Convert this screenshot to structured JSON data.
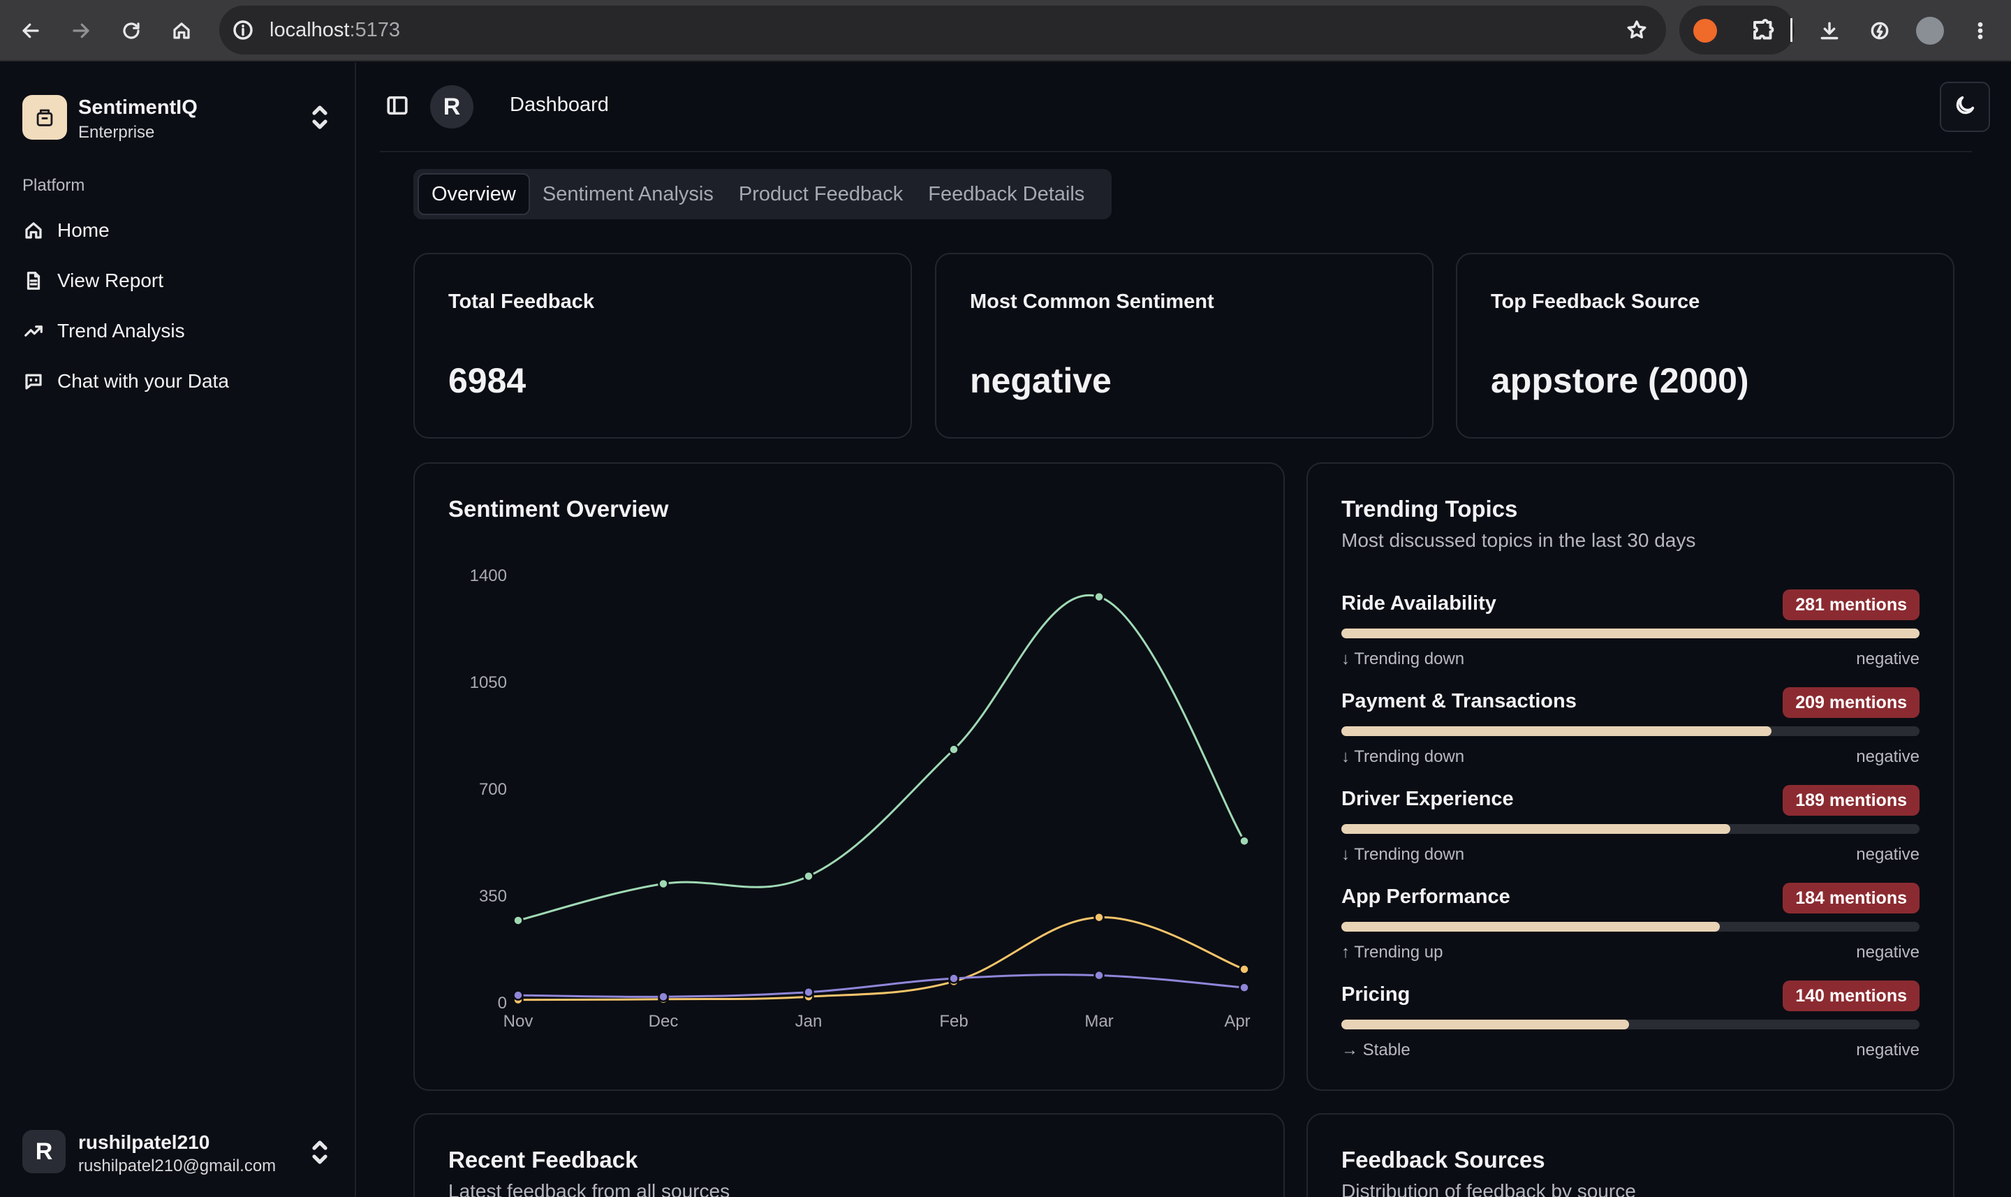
{
  "browser": {
    "url_host": "localhost",
    "url_port": ":5173"
  },
  "sidebar": {
    "brand_name": "SentimentIQ",
    "brand_plan": "Enterprise",
    "section_label": "Platform",
    "items": [
      {
        "label": "Home",
        "icon": "home-icon"
      },
      {
        "label": "View Report",
        "icon": "file-text-icon"
      },
      {
        "label": "Trend Analysis",
        "icon": "trending-up-icon"
      },
      {
        "label": "Chat with your Data",
        "icon": "message-bot-icon"
      }
    ],
    "user": {
      "initial": "R",
      "name": "rushilpatel210",
      "email": "rushilpatel210@gmail.com"
    }
  },
  "header": {
    "avatar_initial": "R",
    "breadcrumb": "Dashboard"
  },
  "tabs": [
    {
      "label": "Overview",
      "active": true
    },
    {
      "label": "Sentiment Analysis",
      "active": false
    },
    {
      "label": "Product Feedback",
      "active": false
    },
    {
      "label": "Feedback Details",
      "active": false
    }
  ],
  "stats": [
    {
      "label": "Total Feedback",
      "value": "6984"
    },
    {
      "label": "Most Common Sentiment",
      "value": "negative"
    },
    {
      "label": "Top Feedback Source",
      "value": "appstore (2000)"
    }
  ],
  "sentiment_card": {
    "title": "Sentiment Overview"
  },
  "chart_data": {
    "type": "line",
    "title": "Sentiment Overview",
    "categories": [
      "Nov",
      "Dec",
      "Jan",
      "Feb",
      "Mar",
      "Apr"
    ],
    "y_ticks": [
      "0",
      "350",
      "700",
      "1050",
      "1400"
    ],
    "ylim": [
      0,
      1400
    ],
    "grid": false,
    "series": [
      {
        "color": "#9fd9b4",
        "values": [
          270,
          390,
          415,
          830,
          1330,
          530
        ]
      },
      {
        "color": "#f4c46a",
        "values": [
          10,
          12,
          20,
          70,
          280,
          110
        ]
      },
      {
        "color": "#8f86d9",
        "values": [
          25,
          20,
          35,
          80,
          90,
          50
        ]
      }
    ]
  },
  "trending": {
    "title": "Trending Topics",
    "subtitle": "Most discussed topics in the last 30 days",
    "topics": [
      {
        "name": "Ride Availability",
        "mentions": "281 mentions",
        "share": 1.0,
        "trend": "↓ Trending down",
        "sentiment": "negative"
      },
      {
        "name": "Payment & Transactions",
        "mentions": "209 mentions",
        "share": 0.744,
        "trend": "↓ Trending down",
        "sentiment": "negative"
      },
      {
        "name": "Driver Experience",
        "mentions": "189 mentions",
        "share": 0.673,
        "trend": "↓ Trending down",
        "sentiment": "negative"
      },
      {
        "name": "App Performance",
        "mentions": "184 mentions",
        "share": 0.655,
        "trend": "↑ Trending up",
        "sentiment": "negative"
      },
      {
        "name": "Pricing",
        "mentions": "140 mentions",
        "share": 0.498,
        "trend": "→ Stable",
        "sentiment": "negative"
      }
    ]
  },
  "recent": {
    "title": "Recent Feedback",
    "subtitle": "Latest feedback from all sources"
  },
  "sources": {
    "title": "Feedback Sources",
    "subtitle": "Distribution of feedback by source"
  }
}
